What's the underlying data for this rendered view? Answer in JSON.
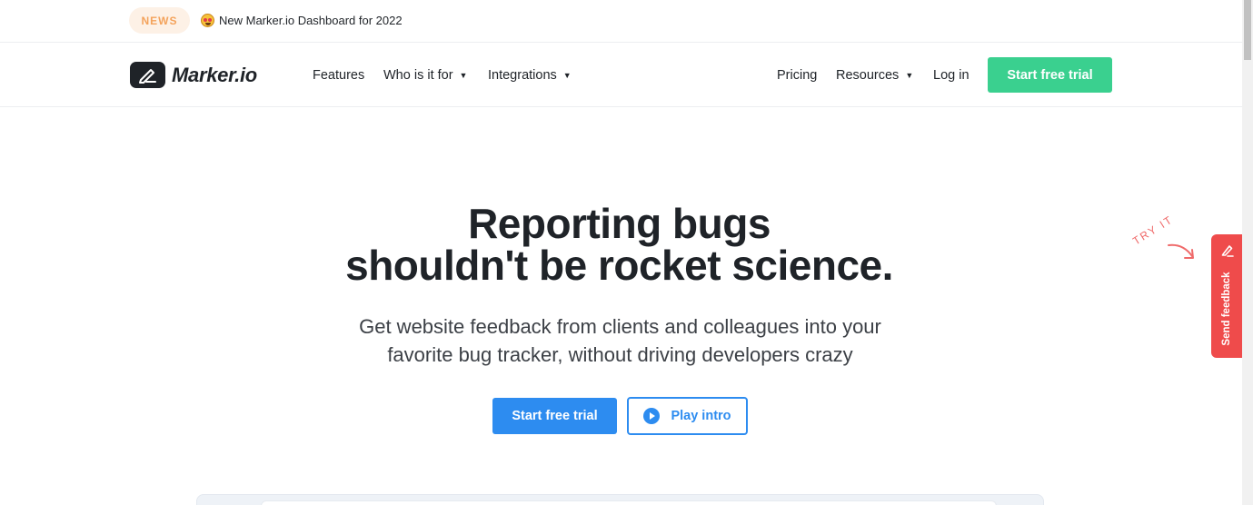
{
  "news": {
    "badge": "NEWS",
    "text": "New Marker.io Dashboard for 2022",
    "emoji_icon": "star-struck-emoji"
  },
  "nav": {
    "logo_text": "Marker.io",
    "links": [
      {
        "label": "Features"
      },
      {
        "label": "Who is it for",
        "dropdown": true
      },
      {
        "label": "Integrations",
        "dropdown": true
      },
      {
        "label": "Pricing"
      },
      {
        "label": "Resources",
        "dropdown": true
      },
      {
        "label": "Log in"
      }
    ],
    "cta_label": "Start free trial",
    "caret": "▼"
  },
  "hero": {
    "title_line1": "Reporting bugs",
    "title_line2": "shouldn't be rocket science.",
    "subtitle_line1": "Get website feedback from clients and colleagues into your",
    "subtitle_line2": "favorite bug tracker, without driving developers crazy",
    "primary_cta": "Start free trial",
    "secondary_cta": "Play intro"
  },
  "feedback_widget": {
    "hint": "TRY IT",
    "label": "Send feedback"
  },
  "colors": {
    "accent_green": "#3ad08f",
    "accent_blue": "#2d8cf0",
    "feedback_red": "#ef4b4b",
    "news_orange": "#f4a35c",
    "text_dark": "#1f2328"
  }
}
